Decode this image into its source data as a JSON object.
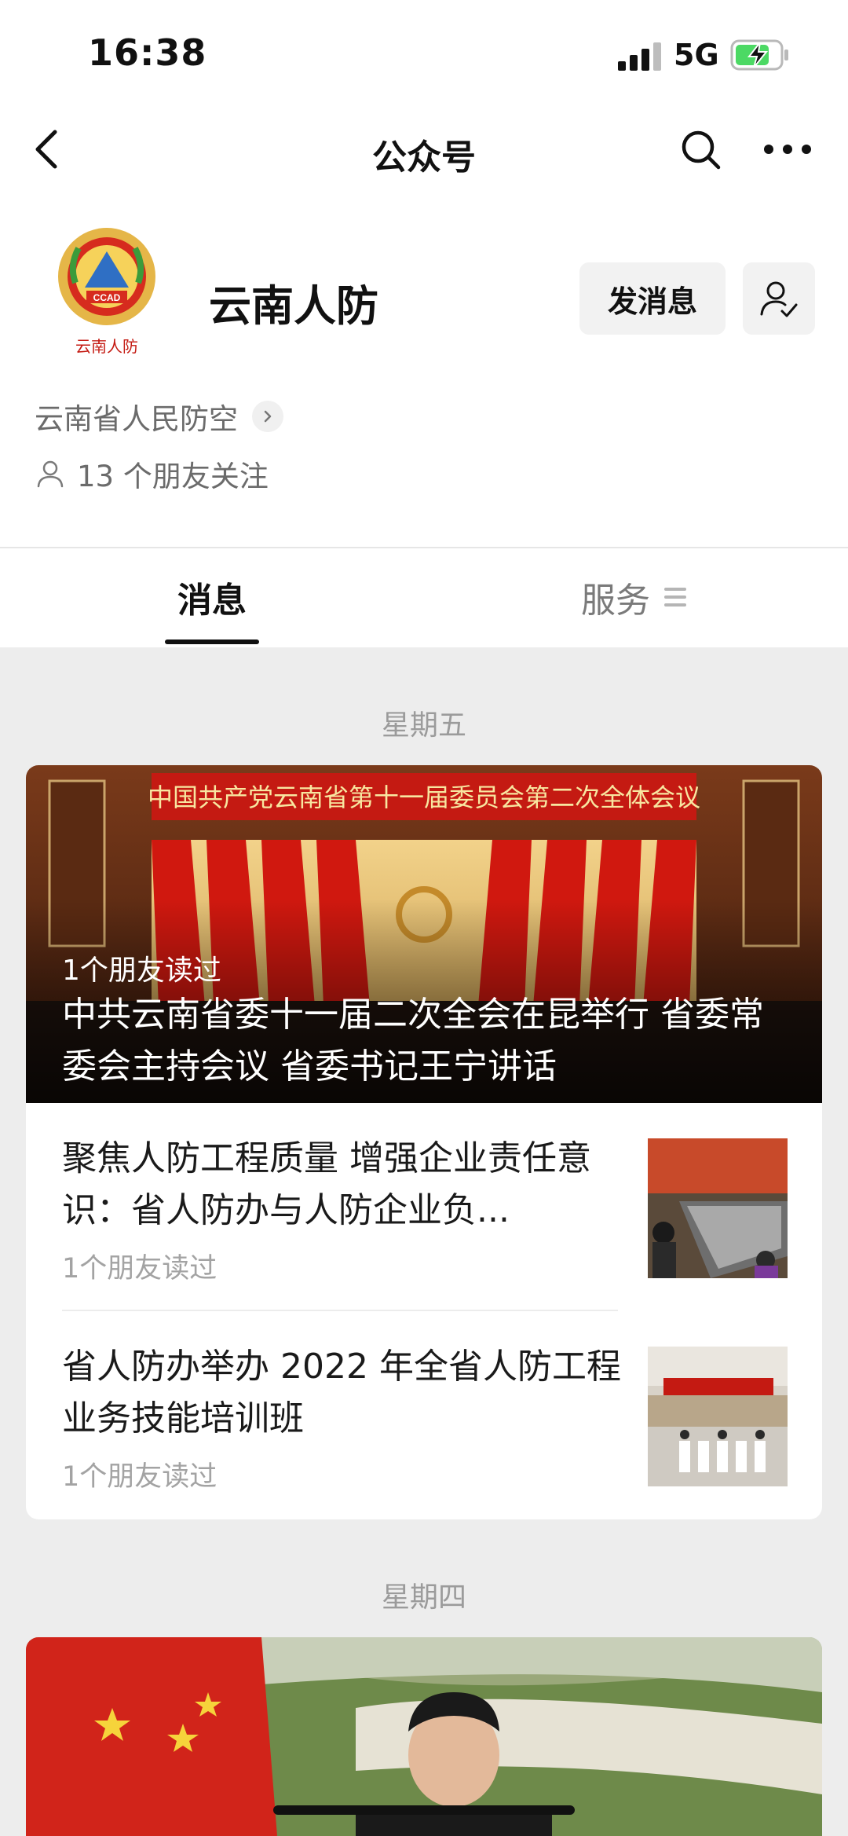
{
  "status_bar": {
    "time": "16:38",
    "network": "5G"
  },
  "nav": {
    "title": "公众号"
  },
  "profile": {
    "name": "云南人防",
    "logo_caption": "云南人防",
    "logo_text": "CCAD",
    "send_message_label": "发消息",
    "org_name": "云南省人民防空",
    "friends_text": "13 个朋友关注"
  },
  "tabs": {
    "messages": "消息",
    "services": "服务"
  },
  "feed": [
    {
      "date": "星期五",
      "cover": {
        "banner": "中国共产党云南省第十一届委员会第二次全体会议",
        "read_by": "1个朋友读过",
        "title": "中共云南省委十一届二次全会在昆举行 省委常委会主持会议 省委书记王宁讲话"
      },
      "articles": [
        {
          "title": "聚焦人防工程质量 增强企业责任意识：省人防办与人防企业负...",
          "read_by": "1个朋友读过",
          "thumb": "meeting"
        },
        {
          "title": "省人防办举办 2022 年全省人防工程业务技能培训班",
          "read_by": "1个朋友读过",
          "thumb": "training"
        }
      ]
    },
    {
      "date": "星期四"
    }
  ],
  "colors": {
    "accent_red": "#c41a12",
    "gold": "#e5b648",
    "page_bg": "#ededed"
  }
}
